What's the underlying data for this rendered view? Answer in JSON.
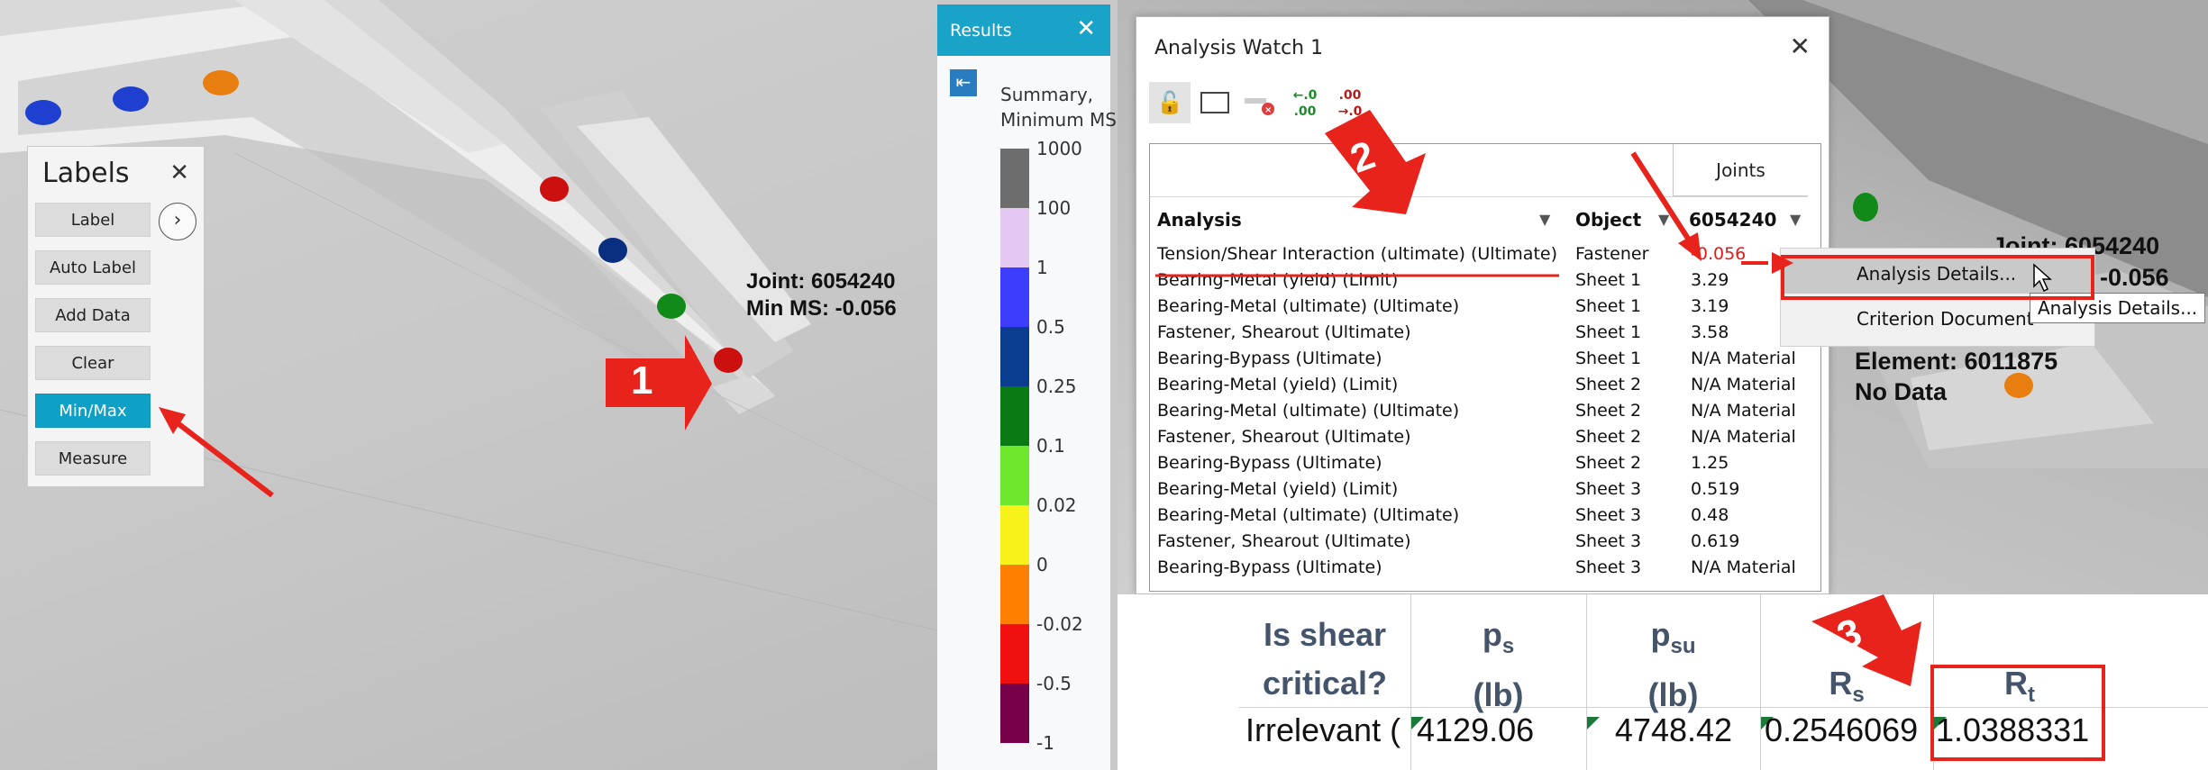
{
  "labels_panel": {
    "title": "Labels",
    "buttons": [
      "Label",
      "Auto Label",
      "Add Data",
      "Clear",
      "Min/Max",
      "Measure"
    ],
    "active": "Min/Max"
  },
  "viewport": {
    "joint_label": "Joint: 6054240",
    "minms_label": "Min MS: -0.056",
    "right_joint_label": "Joint: 6054240",
    "right_value": "-0.056",
    "element_label": "Element: 6011875",
    "nodata_label": "No Data"
  },
  "results_panel": {
    "title": "Results",
    "subtitle_line1": "Summary,",
    "subtitle_line2": "Minimum MS",
    "legend": [
      {
        "label": "1000",
        "color": "#6d6d6d"
      },
      {
        "label": "100",
        "color": "#e5c8f2"
      },
      {
        "label": "1",
        "color": "#3d3dff"
      },
      {
        "label": "0.5",
        "color": "#0a3d8f"
      },
      {
        "label": "0.25",
        "color": "#0a7a14"
      },
      {
        "label": "0.1",
        "color": "#6ee82d"
      },
      {
        "label": "0.02",
        "color": "#f7f21a"
      },
      {
        "label": "0",
        "color": "#ff7f00"
      },
      {
        "label": "-0.02",
        "color": "#f01010"
      },
      {
        "label": "-0.5",
        "color": "#780048"
      },
      {
        "label": "-1",
        "color": ""
      }
    ]
  },
  "analysis_watch": {
    "title": "Analysis Watch 1",
    "joints_header": "Joints",
    "columns": {
      "analysis": "Analysis",
      "object": "Object",
      "joint": "6054240"
    },
    "rows": [
      {
        "analysis": "Tension/Shear Interaction (ultimate) (Ultimate)",
        "object": "Fastener",
        "value": "-0.056"
      },
      {
        "analysis": "Bearing-Metal (yield) (Limit)",
        "object": "Sheet 1",
        "value": "3.29"
      },
      {
        "analysis": "Bearing-Metal (ultimate) (Ultimate)",
        "object": "Sheet 1",
        "value": "3.19"
      },
      {
        "analysis": "Fastener, Shearout (Ultimate)",
        "object": "Sheet 1",
        "value": "3.58"
      },
      {
        "analysis": "Bearing-Bypass (Ultimate)",
        "object": "Sheet 1",
        "value": "N/A Material"
      },
      {
        "analysis": "Bearing-Metal (yield) (Limit)",
        "object": "Sheet 2",
        "value": "N/A Material"
      },
      {
        "analysis": "Bearing-Metal (ultimate) (Ultimate)",
        "object": "Sheet 2",
        "value": "N/A Material"
      },
      {
        "analysis": "Fastener, Shearout (Ultimate)",
        "object": "Sheet 2",
        "value": "N/A Material"
      },
      {
        "analysis": "Bearing-Bypass (Ultimate)",
        "object": "Sheet 2",
        "value": "1.25"
      },
      {
        "analysis": "Bearing-Metal (yield) (Limit)",
        "object": "Sheet 3",
        "value": "0.519"
      },
      {
        "analysis": "Bearing-Metal (ultimate) (Ultimate)",
        "object": "Sheet 3",
        "value": "0.48"
      },
      {
        "analysis": "Fastener, Shearout (Ultimate)",
        "object": "Sheet 3",
        "value": "0.619"
      },
      {
        "analysis": "Bearing-Bypass (Ultimate)",
        "object": "Sheet 3",
        "value": "N/A Material"
      }
    ],
    "toolbar_icons": [
      "lock-icon",
      "select-rectangle-icon",
      "clear-icon",
      "increase-decimals-icon",
      "decrease-decimals-icon"
    ],
    "toolbar_glyphs": [
      "🔓",
      "",
      "",
      "←.0 .00",
      ".00 →.0"
    ]
  },
  "context_menu": {
    "items": [
      "Analysis Details...",
      "Criterion Document"
    ],
    "tooltip": "Analysis Details..."
  },
  "spreadsheet": {
    "headers": [
      {
        "line1": "Is shear",
        "line2": "critical?"
      },
      {
        "line1": "p",
        "sub1": "s",
        "line2": "(lb)"
      },
      {
        "line1": "p",
        "sub1": "su",
        "line2": "(lb)"
      },
      {
        "line1": "",
        "line2": "R",
        "sub2": "s"
      },
      {
        "line1": "",
        "line2": "R",
        "sub2": "t"
      }
    ],
    "values": [
      "Irrelevant (",
      "4129.06",
      "4748.42",
      "0.2546069",
      "1.0388331"
    ]
  },
  "annotations": {
    "step1": "1",
    "step2": "2",
    "step3": "3"
  },
  "colors": {
    "accent": "#1aa3c9",
    "annotation_red": "#e8231c",
    "negative": "#e01a1a"
  }
}
